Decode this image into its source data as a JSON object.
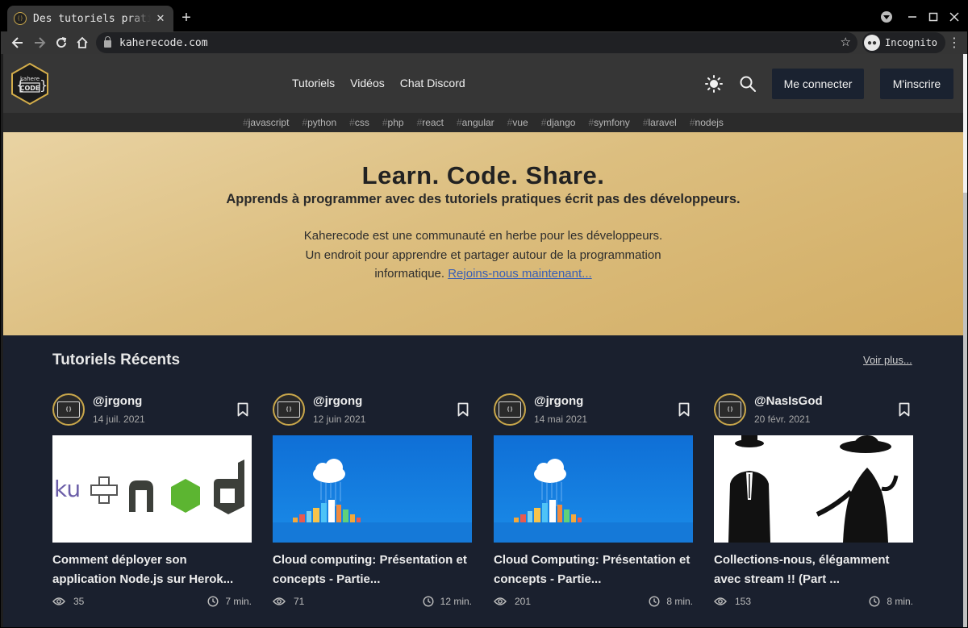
{
  "browser": {
    "tab_title": "Des tutoriels pratiques",
    "url": "kaherecode.com",
    "incognito_label": "Incognito"
  },
  "header": {
    "nav": [
      "Tutoriels",
      "Vidéos",
      "Chat Discord"
    ],
    "login_label": "Me connecter",
    "signup_label": "M'inscrire",
    "logo_text_top": "kahere",
    "logo_text_bottom": "CODE"
  },
  "tags": [
    "javascript",
    "python",
    "css",
    "php",
    "react",
    "angular",
    "vue",
    "django",
    "symfony",
    "laravel",
    "nodejs"
  ],
  "hero": {
    "title": "Learn. Code. Share.",
    "subtitle": "Apprends à programmer avec des tutoriels pratiques écrit pas des développeurs.",
    "desc_line1": "Kaherecode est une communauté en herbe pour les développeurs.",
    "desc_line2": "Un endroit pour apprendre et partager autour de la programmation informatique.",
    "join_link": "Rejoins-nous maintenant..."
  },
  "recent": {
    "title": "Tutoriels Récents",
    "see_more": "Voir plus...",
    "cards": [
      {
        "author": "@jrgong",
        "date": "14 juil. 2021",
        "title": "Comment déployer son application Node.js sur Herok...",
        "views": "35",
        "time": "7 min."
      },
      {
        "author": "@jrgong",
        "date": "12 juin 2021",
        "title": "Cloud computing: Présentation et concepts - Partie...",
        "views": "71",
        "time": "12 min."
      },
      {
        "author": "@jrgong",
        "date": "14 mai 2021",
        "title": "Cloud Computing: Présentation et concepts - Partie...",
        "views": "201",
        "time": "8 min."
      },
      {
        "author": "@NasIsGod",
        "date": "20 févr. 2021",
        "title": "Collections-nous, élégamment avec stream !! (Part ...",
        "views": "153",
        "time": "8 min."
      }
    ]
  },
  "colors": {
    "accent_gold": "#c9a74b",
    "page_bg": "#1a202e",
    "header_bg": "#363636"
  }
}
